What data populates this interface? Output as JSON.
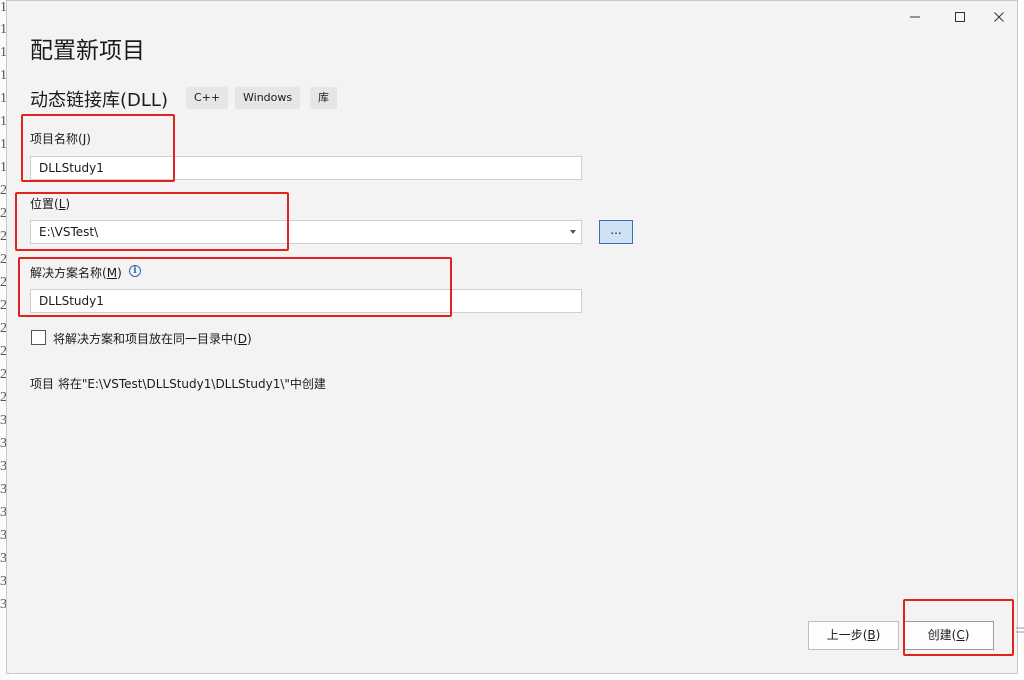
{
  "background": {
    "line_digits": [
      "1",
      "1",
      "1",
      "1",
      "1",
      "1",
      "1",
      "1",
      "2",
      "2",
      "2",
      "2",
      "2",
      "2",
      "2",
      "2",
      "2",
      "2",
      "3",
      "3",
      "3",
      "3",
      "3",
      "3",
      "3",
      "3",
      "3"
    ]
  },
  "window": {
    "title": "配置新项目",
    "controls": [
      "minimize-icon",
      "maximize-icon",
      "close-icon"
    ]
  },
  "template": {
    "name": "动态链接库(DLL)",
    "tags": [
      "C++",
      "Windows",
      "库"
    ]
  },
  "project_name": {
    "label": "项目名称",
    "access_key": "J",
    "value": "DLLStudy1"
  },
  "location": {
    "label": "位置",
    "access_key": "L",
    "value": "E:\\VSTest\\",
    "browse_label": "..."
  },
  "solution_name": {
    "label": "解决方案名称",
    "access_key": "M",
    "value": "DLLStudy1",
    "info_icon": "info-icon"
  },
  "place_in_same_dir": {
    "label": "将解决方案和项目放在同一目录中",
    "access_key": "D",
    "checked": false
  },
  "summary": "项目 将在\"E:\\VSTest\\DLLStudy1\\DLLStudy1\\\"中创建",
  "footer": {
    "back_label": "上一步",
    "back_key": "B",
    "create_label": "创建",
    "create_key": "C"
  },
  "colors": {
    "dialog_bg": "#f3f3f3",
    "highlight": "#e0231c",
    "browse_bg": "#cfe1f5",
    "browse_border": "#3d6fb3",
    "info": "#2b6cb0"
  }
}
